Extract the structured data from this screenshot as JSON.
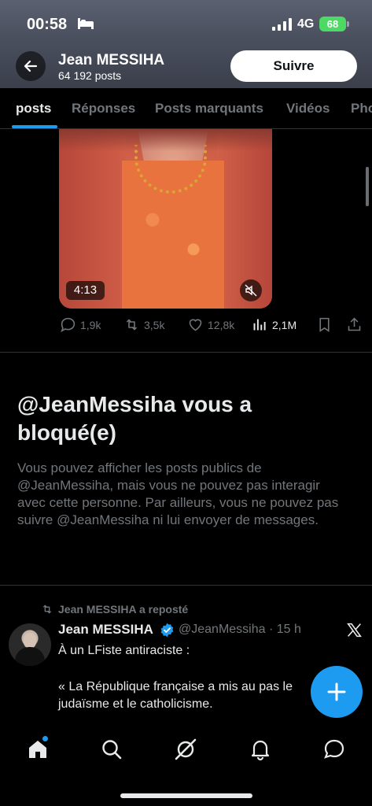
{
  "status_bar": {
    "time": "00:58",
    "network": "4G",
    "battery": "68"
  },
  "header": {
    "name": "Jean MESSIHA",
    "posts_count": "64 192 posts",
    "follow_label": "Suivre"
  },
  "tabs": [
    {
      "label": "posts",
      "active": true
    },
    {
      "label": "Réponses",
      "active": false
    },
    {
      "label": "Posts marquants",
      "active": false
    },
    {
      "label": "Vidéos",
      "active": false
    },
    {
      "label": "Pho",
      "active": false
    }
  ],
  "video_post": {
    "duration": "4:13",
    "replies": "1,9k",
    "reposts": "3,5k",
    "likes": "12,8k",
    "views": "2,1M"
  },
  "blocked": {
    "title": "@JeanMessiha vous a bloqué(e)",
    "text": "Vous pouvez afficher les posts publics de @JeanMessiha, mais vous ne pouvez pas interagir avec cette personne. Par ailleurs, vous ne pouvez pas suivre @JeanMessiha ni lui envoyer de messages."
  },
  "repost": {
    "label": "Jean MESSIHA a reposté",
    "name": "Jean MESSIHA",
    "handle_time": "@JeanMessiha · 15 h",
    "line1": "À un LFiste antiraciste :",
    "line2": "« La République française a mis au pas le judaïsme et le catholicisme."
  },
  "colors": {
    "accent": "#1d9bf0",
    "muted": "#71767b",
    "background": "#000000"
  },
  "nav": [
    "home-icon",
    "search-icon",
    "grok-icon",
    "notifications-icon",
    "messages-icon"
  ]
}
